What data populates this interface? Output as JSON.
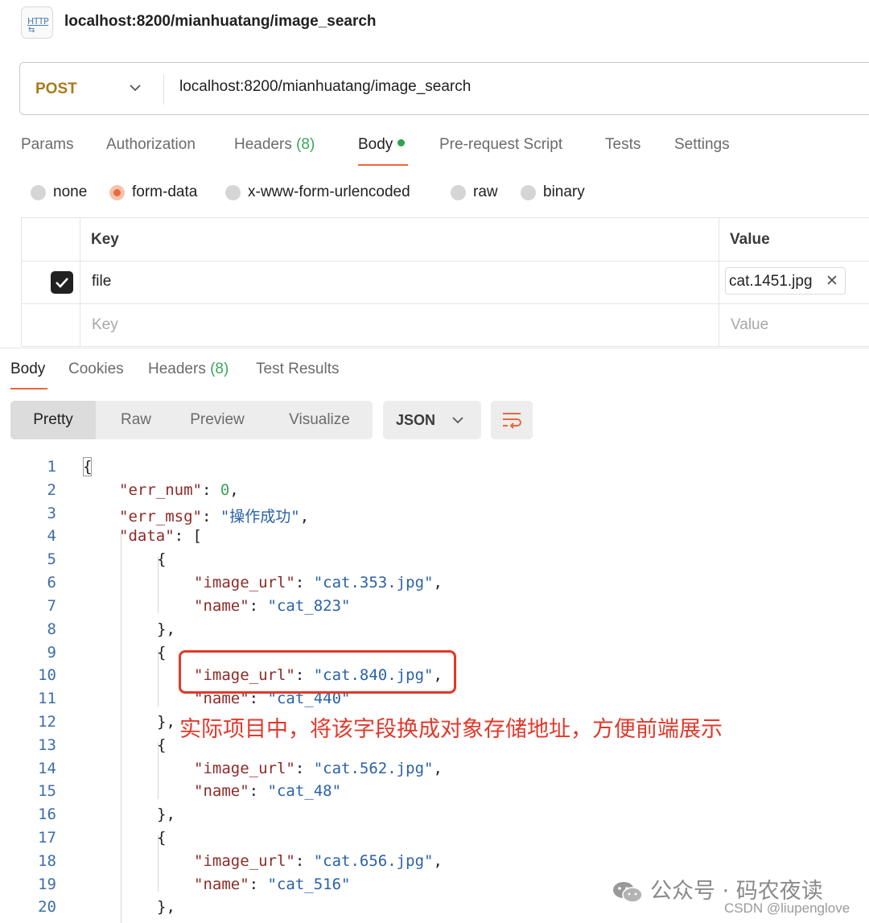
{
  "window": {
    "tab_icon_text": "HTTP",
    "title": "localhost:8200/mianhuatang/image_search"
  },
  "request": {
    "method": "POST",
    "url": "localhost:8200/mianhuatang/image_search",
    "tabs": [
      {
        "label": "Params"
      },
      {
        "label": "Authorization"
      },
      {
        "label": "Headers",
        "count": "(8)"
      },
      {
        "label": "Body"
      },
      {
        "label": "Pre-request Script"
      },
      {
        "label": "Tests"
      },
      {
        "label": "Settings"
      }
    ],
    "active_tab": "Body",
    "body_types": [
      "none",
      "form-data",
      "x-www-form-urlencoded",
      "raw",
      "binary"
    ],
    "selected_body_type": "form-data",
    "form": {
      "key_header": "Key",
      "value_header": "Value",
      "rows": [
        {
          "checked": true,
          "key": "file",
          "value": "cat.1451.jpg"
        }
      ],
      "key_placeholder": "Key",
      "value_placeholder": "Value"
    }
  },
  "response": {
    "tabs": [
      {
        "label": "Body"
      },
      {
        "label": "Cookies"
      },
      {
        "label": "Headers",
        "count": "(8)"
      },
      {
        "label": "Test Results"
      }
    ],
    "active_tab": "Body",
    "views": [
      "Pretty",
      "Raw",
      "Preview",
      "Visualize"
    ],
    "active_view": "Pretty",
    "format": "JSON",
    "line_numbers": [
      "1",
      "2",
      "3",
      "4",
      "5",
      "6",
      "7",
      "8",
      "9",
      "10",
      "11",
      "12",
      "13",
      "14",
      "15",
      "16",
      "17",
      "18",
      "19",
      "20"
    ],
    "annotation": "实际项目中，将该字段换成对象存储地址，方便前端展示"
  },
  "json": {
    "err_num": "0",
    "err_msg": "\"操作成功\"",
    "items": [
      {
        "image_url": "\"cat.353.jpg\"",
        "name": "\"cat_823\""
      },
      {
        "image_url": "\"cat.840.jpg\"",
        "name": "\"cat_440\""
      },
      {
        "image_url": "\"cat.562.jpg\"",
        "name": "\"cat_48\""
      },
      {
        "image_url": "\"cat.656.jpg\"",
        "name": "\"cat_516\""
      }
    ]
  },
  "watermark": {
    "wechat": "公众号 · 码农夜读",
    "csdn": "CSDN @liupenglove"
  },
  "colors": {
    "accent": "#e8693b",
    "method": "#a87a1b",
    "json_key": "#8e2a27",
    "json_string": "#2a62a8",
    "annotation": "#e0392b"
  }
}
